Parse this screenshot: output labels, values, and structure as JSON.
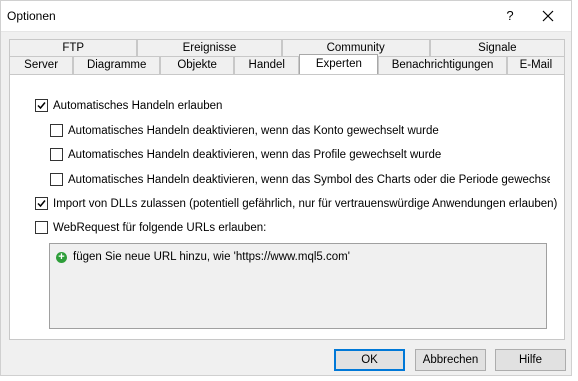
{
  "window": {
    "title": "Optionen",
    "help_label": "?"
  },
  "tabs": {
    "row_back": [
      {
        "label": "FTP"
      },
      {
        "label": "Ereignisse"
      },
      {
        "label": "Community"
      },
      {
        "label": "Signale"
      }
    ],
    "row_front": [
      {
        "label": "Server"
      },
      {
        "label": "Diagramme"
      },
      {
        "label": "Objekte"
      },
      {
        "label": "Handel"
      },
      {
        "label": "Experten",
        "active": true
      },
      {
        "label": "Benachrichtigungen"
      },
      {
        "label": "E-Mail"
      }
    ]
  },
  "experts": {
    "options": [
      {
        "label": "Automatisches Handeln erlauben",
        "checked": true
      },
      {
        "label": "Automatisches Handeln deaktivieren, wenn das Konto gewechselt wurde",
        "checked": false
      },
      {
        "label": "Automatisches Handeln deaktivieren, wenn das Profile gewechselt wurde",
        "checked": false
      },
      {
        "label": "Automatisches Handeln deaktivieren, wenn das Symbol des Charts oder die Periode gewechselt wurde",
        "checked": false
      },
      {
        "label": "Import von DLLs zulassen (potentiell gefährlich, nur für vertrauenswürdige Anwendungen erlauben)",
        "checked": true
      },
      {
        "label": "WebRequest für folgende URLs erlauben:",
        "checked": false
      }
    ],
    "url_list": {
      "add_item": "fügen Sie neue URL hinzu, wie 'https://www.mql5.com'"
    }
  },
  "buttons": {
    "ok": "OK",
    "cancel": "Abbrechen",
    "help": "Hilfe"
  }
}
